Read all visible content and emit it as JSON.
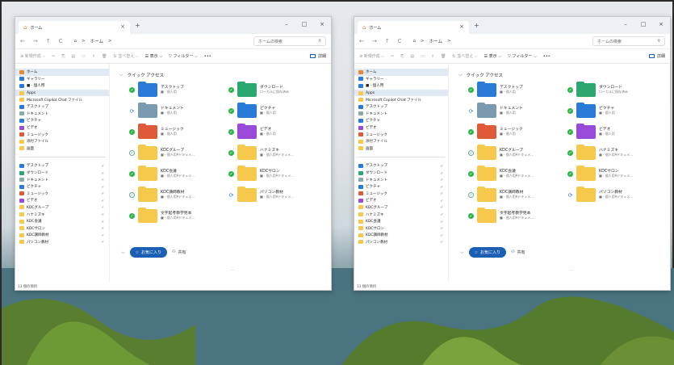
{
  "colors": {
    "accent": "#1a5fb4",
    "folder": "#f6c84c",
    "selected": "#e1e9f3",
    "sync_ok": "#2db54a"
  },
  "windows": [
    {
      "tab": {
        "title": "ホーム",
        "close": "×",
        "new": "+"
      },
      "controls": {
        "min": "–",
        "max": "□",
        "close": "×"
      },
      "nav": {
        "back": "←",
        "forward": "→",
        "up": "↑",
        "refresh": "C",
        "home_icon": "⌂",
        "crumb_sep1": ">",
        "crumb": "ホーム",
        "crumb_sep2": ">"
      },
      "search": {
        "placeholder": "ホームの検索",
        "icon": "⚲"
      },
      "toolbar": {
        "new": "⊕ 新規作成 ⌵",
        "sort": "⇅ 並べ替え ⌵",
        "view": "☰ 表示 ⌵",
        "filter": "▽ フィルター ⌵",
        "more": "•••",
        "details": "詳細"
      },
      "sidebar": [
        {
          "label": "ホーム",
          "icon": "home-icon",
          "color": "#e08a3a",
          "sel": true,
          "pin": ""
        },
        {
          "label": "ギャラリー",
          "icon": "gallery-icon",
          "color": "#2a7ad8",
          "sel": false,
          "pin": ""
        },
        {
          "label": "■ - 個人用",
          "icon": "onedrive-icon",
          "color": "#2a7ad8",
          "sel": false,
          "pin": ""
        },
        {
          "label": "Apps",
          "icon": "folder-icon",
          "color": "#f6c84c",
          "sel": true,
          "pin": ""
        },
        {
          "label": "Microsoft Copilot Chat ファイル",
          "icon": "folder-icon",
          "color": "#f6c84c",
          "sel": false,
          "pin": ""
        },
        {
          "label": "デスクトップ",
          "icon": "desktop-icon",
          "color": "#2a7ad8",
          "sel": false,
          "pin": ""
        },
        {
          "label": "ドキュメント",
          "icon": "document-icon",
          "color": "#8aa",
          "sel": false,
          "pin": ""
        },
        {
          "label": "ピクチャ",
          "icon": "pictures-icon",
          "color": "#2a7ad8",
          "sel": false,
          "pin": ""
        },
        {
          "label": "ビデオ",
          "icon": "video-icon",
          "color": "#9a4ad8",
          "sel": false,
          "pin": ""
        },
        {
          "label": "ミュージック",
          "icon": "music-icon",
          "color": "#e05a3a",
          "sel": false,
          "pin": ""
        },
        {
          "label": "添付ファイル",
          "icon": "folder-icon",
          "color": "#f6c84c",
          "sel": false,
          "pin": ""
        },
        {
          "label": "画面",
          "icon": "folder-icon",
          "color": "#f6c84c",
          "sel": false,
          "pin": ""
        },
        {
          "sep": true
        },
        {
          "label": "デスクトップ",
          "icon": "desktop-icon",
          "color": "#2a7ad8",
          "sel": false,
          "pin": "✐"
        },
        {
          "label": "ダウンロード",
          "icon": "download-icon",
          "color": "#2aa870",
          "sel": false,
          "pin": "✐"
        },
        {
          "label": "ドキュメント",
          "icon": "document-icon",
          "color": "#8aa",
          "sel": false,
          "pin": "✐"
        },
        {
          "label": "ピクチャ",
          "icon": "pictures-icon",
          "color": "#2a7ad8",
          "sel": false,
          "pin": "✐"
        },
        {
          "label": "ミュージック",
          "icon": "music-icon",
          "color": "#e05a3a",
          "sel": false,
          "pin": "✐"
        },
        {
          "label": "ビデオ",
          "icon": "video-icon",
          "color": "#9a4ad8",
          "sel": false,
          "pin": "✐"
        },
        {
          "label": "KDCグループ",
          "icon": "folder-icon",
          "color": "#f6c84c",
          "sel": false,
          "pin": "✐"
        },
        {
          "label": "ハナミズキ",
          "icon": "folder-icon",
          "color": "#f6c84c",
          "sel": false,
          "pin": "✐"
        },
        {
          "label": "KDC会議",
          "icon": "folder-icon",
          "color": "#f6c84c",
          "sel": false,
          "pin": "✐"
        },
        {
          "label": "KDCサロン",
          "icon": "folder-icon",
          "color": "#f6c84c",
          "sel": false,
          "pin": "✐"
        },
        {
          "label": "KDC講師教材",
          "icon": "folder-icon",
          "color": "#f6c84c",
          "sel": false,
          "pin": "✐"
        },
        {
          "label": "パソコン教材",
          "icon": "folder-icon",
          "color": "#f6c84c",
          "sel": false,
          "pin": "✐"
        }
      ],
      "quick_access": "クイック アクセス",
      "tiles": [
        {
          "name": "デスクトップ",
          "sub": "■ - 個人用",
          "status": "ok",
          "color": "#2a7ad8"
        },
        {
          "name": "ダウンロード",
          "sub": "ローカルに保存済み",
          "status": "ok",
          "color": "#2aa870"
        },
        {
          "name": "ドキュメント",
          "sub": "■ - 個人用",
          "status": "sync",
          "color": "#7a9ab0"
        },
        {
          "name": "ピクチャ",
          "sub": "■ - 個人用",
          "status": "ok",
          "color": "#2a7ad8"
        },
        {
          "name": "ミュージック",
          "sub": "■ - 個人用",
          "status": "ok",
          "color": "#e05a3a"
        },
        {
          "name": "ビデオ",
          "sub": "■ - 個人用",
          "status": "ok",
          "color": "#9a4ad8"
        },
        {
          "name": "KDCグループ",
          "sub": "■ - 個人用¥ドキュメ...",
          "status": "hollow",
          "color": "#f6c84c"
        },
        {
          "name": "ハナミズキ",
          "sub": "■ - 個人用¥ドキュメ...",
          "status": "ok",
          "color": "#f6c84c"
        },
        {
          "name": "KDC会議",
          "sub": "■ - 個人用¥ドキュメ...",
          "status": "ok",
          "color": "#f6c84c"
        },
        {
          "name": "KDCサロン",
          "sub": "■ - 個人用¥ドキュメ...",
          "status": "ok",
          "color": "#f6c84c"
        },
        {
          "name": "KDC講師教材",
          "sub": "■ - 個人用¥ドキュメ...",
          "status": "hollow",
          "color": "#f6c84c"
        },
        {
          "name": "パソコン教材",
          "sub": "■ - 個人用¥ドキュメ...",
          "status": "sync",
          "color": "#f6c84c"
        },
        {
          "name": "文字起考教学見本",
          "sub": "■ - 個人用¥ドキュメ...",
          "status": "ok",
          "color": "#f6c84c"
        }
      ],
      "favorites": "お気に入り",
      "shared": "共有",
      "status": "13 個の項目"
    }
  ]
}
